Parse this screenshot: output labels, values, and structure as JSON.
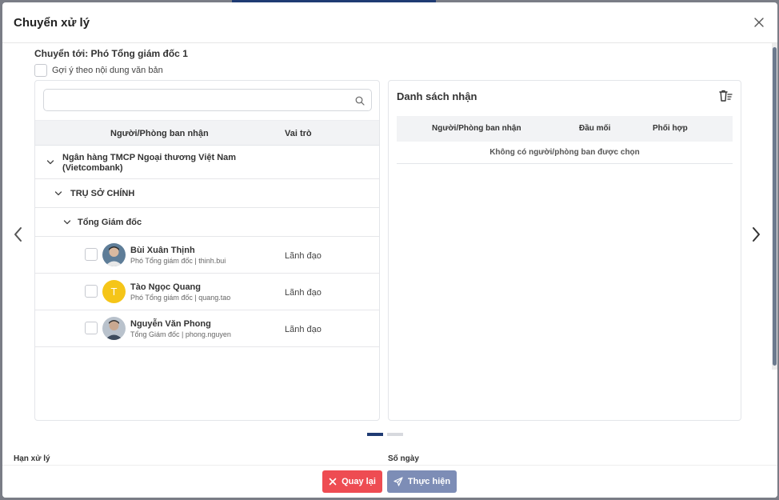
{
  "modal": {
    "title": "Chuyển xử lý",
    "forward_to": "Chuyển tới: Phó Tổng giám đốc 1",
    "suggest_label": "Gợi ý theo nội dung văn bản"
  },
  "search": {
    "placeholder": "",
    "icon": "search-icon"
  },
  "left_table": {
    "headers": {
      "recipient": "Người/Phòng ban nhận",
      "role": "Vai trò"
    },
    "tree": {
      "org": "Ngân hàng TMCP Ngoại thương Việt Nam (Vietcombank)",
      "branch": "TRỤ SỞ CHÍNH",
      "dept": "Tổng Giám đốc"
    },
    "people": [
      {
        "name": "Bùi Xuân Thịnh",
        "sub": "Phó Tổng giám đốc | thinh.bui",
        "role": "Lãnh đạo",
        "avatar": "photo"
      },
      {
        "name": "Tào Ngọc Quang",
        "sub": "Phó Tổng giám đốc | quang.tao",
        "role": "Lãnh đạo",
        "avatar": "T",
        "avatar_color": "#f5c518"
      },
      {
        "name": "Nguyễn Văn Phong",
        "sub": "Tổng Giám đốc | phong.nguyen",
        "role": "Lãnh đạo",
        "avatar": "photo"
      }
    ]
  },
  "receive_list": {
    "title": "Danh sách nhận",
    "headers": {
      "recipient": "Người/Phòng ban nhận",
      "focal": "Đầu mối",
      "coordinate": "Phối hợp"
    },
    "empty_text": "Không có người/phòng ban được chọn"
  },
  "pagination": {
    "pages": 2,
    "active": 1
  },
  "fields": {
    "deadline_label": "Hạn xử lý",
    "days_label": "Số ngày"
  },
  "buttons": {
    "back_label": "Quay lại",
    "submit_label": "Thực hiện"
  },
  "colors": {
    "primary": "#1f3b73",
    "danger": "#ee4c52",
    "submit": "#7d8db6"
  }
}
